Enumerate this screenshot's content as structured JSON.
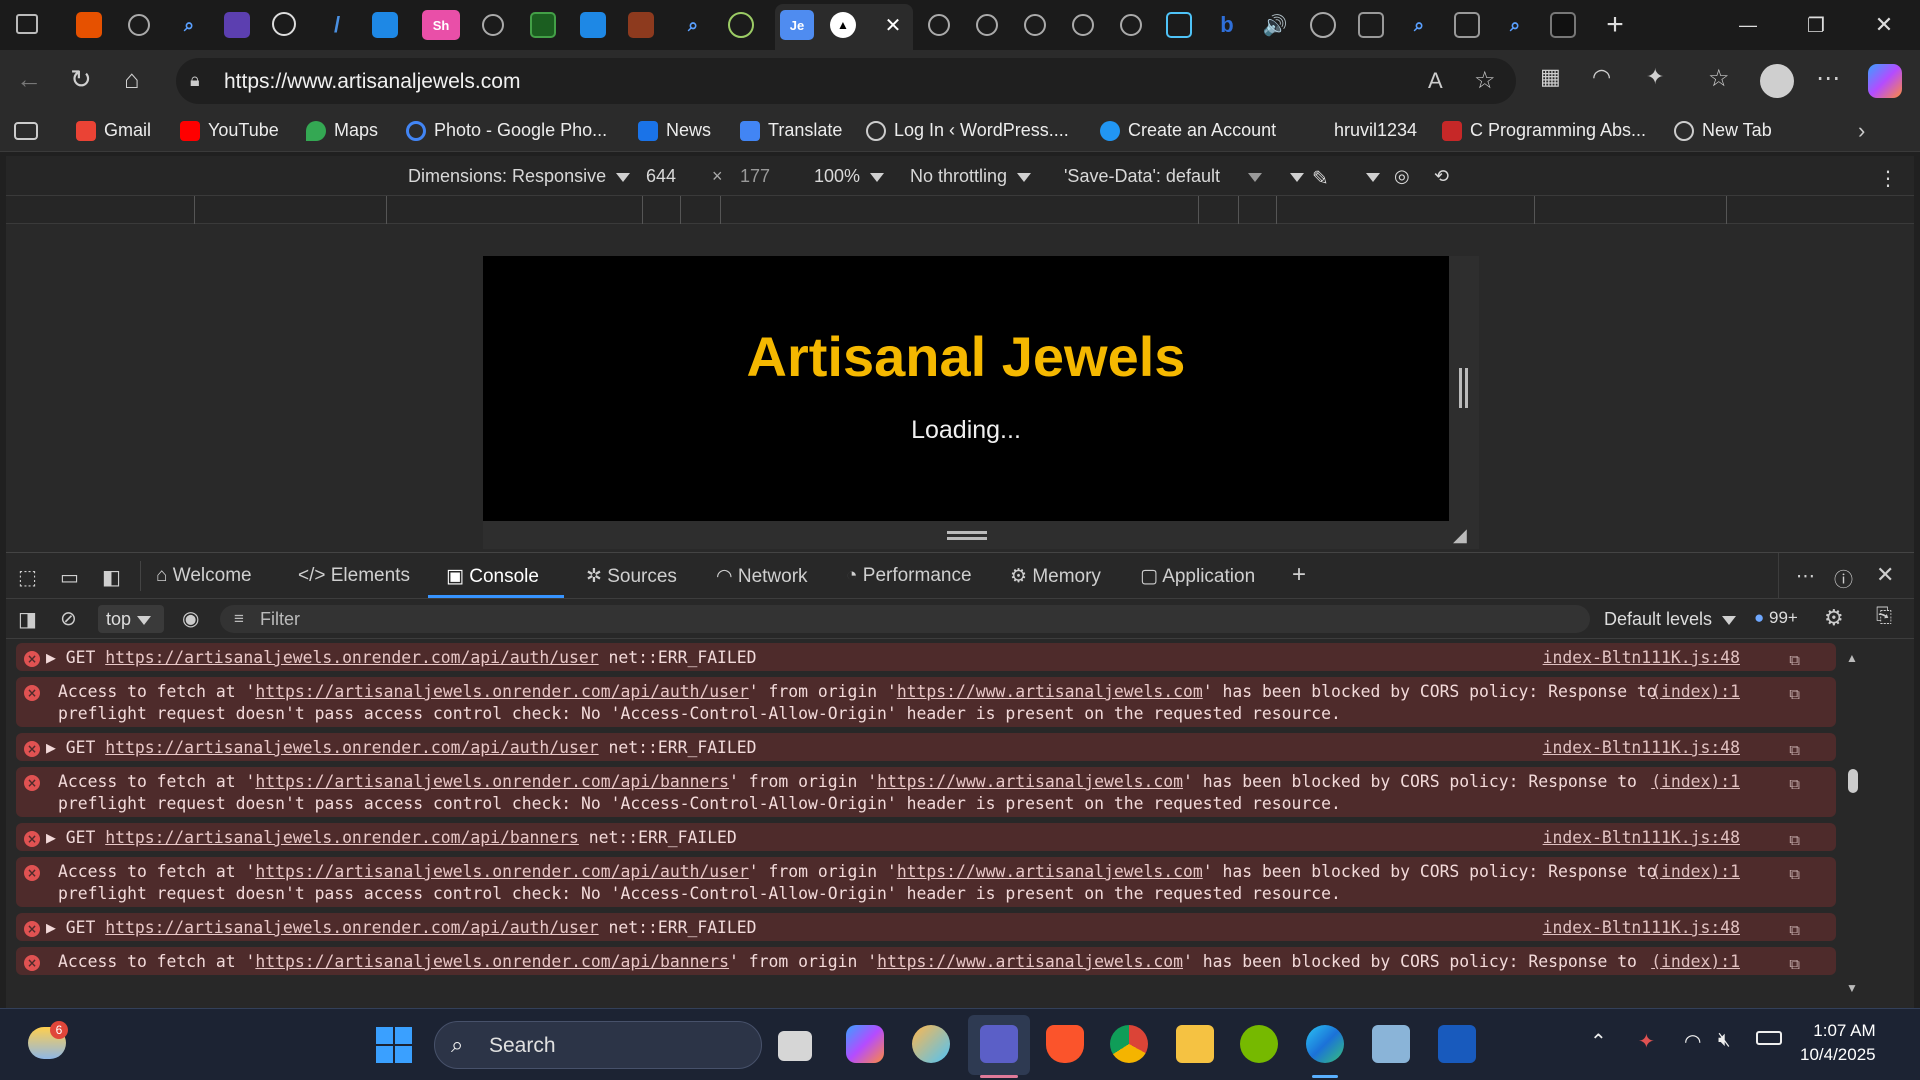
{
  "tabs": {
    "small_labels": [
      "Sh",
      "Je"
    ],
    "active_close": "✕",
    "new_tab": "+"
  },
  "window": {
    "minimize": "—",
    "restore": "❐",
    "close": "✕"
  },
  "address": {
    "url": "https://www.artisanaljewels.com"
  },
  "bookmarks": [
    {
      "label": "Gmail",
      "color": "#ea4335"
    },
    {
      "label": "YouTube",
      "color": "#ff0000"
    },
    {
      "label": "Maps",
      "color": "#34a853"
    },
    {
      "label": "Photo - Google Pho...",
      "color": "#4285f4"
    },
    {
      "label": "News",
      "color": "#1a73e8"
    },
    {
      "label": "Translate",
      "color": "#4285f4"
    },
    {
      "label": "Log In ‹ WordPress....",
      "color": "#cccccc"
    },
    {
      "label": "Create an Account",
      "color": "#2196f3"
    },
    {
      "label": "hruvil1234",
      "color": "#2b2b2b"
    },
    {
      "label": "C Programming Abs...",
      "color": "#c62828"
    },
    {
      "label": "New Tab",
      "color": "#cccccc"
    }
  ],
  "device_toolbar": {
    "dimensions": "Dimensions: Responsive",
    "width": "644",
    "times": "×",
    "height": "177",
    "zoom": "100%",
    "throttling": "No throttling",
    "save_data": "'Save-Data': default",
    "more": "⋮"
  },
  "site": {
    "title": "Artisanal Jewels",
    "status": "Loading...",
    "title_color": "#f5b800"
  },
  "devtools_tabs": [
    "Welcome",
    "Elements",
    "Console",
    "Sources",
    "Network",
    "Performance",
    "Memory",
    "Application"
  ],
  "devtools_active_tab": "Console",
  "console_bar": {
    "context": "top",
    "filter_placeholder": "Filter",
    "levels": "Default levels",
    "issues_count": "99+"
  },
  "messages": [
    {
      "type": "get",
      "prefix": "GET ",
      "url": "https://artisanaljewels.onrender.com/api/auth/user",
      "suffix": " net::ERR_FAILED",
      "source": "index-Bltn111K.js:48"
    },
    {
      "type": "cors",
      "p1": "Access to fetch at '",
      "url": "https://artisanaljewels.onrender.com/api/auth/user",
      "p2": "' from origin '",
      "origin": "https://www.artisanaljewels.com",
      "p3": "' has been blocked by CORS policy: Response to\npreflight request doesn't pass access control check: No 'Access-Control-Allow-Origin' header is present on the requested resource.",
      "source": "(index):1"
    },
    {
      "type": "get",
      "prefix": "GET ",
      "url": "https://artisanaljewels.onrender.com/api/auth/user",
      "suffix": " net::ERR_FAILED",
      "source": "index-Bltn111K.js:48"
    },
    {
      "type": "cors",
      "p1": "Access to fetch at '",
      "url": "https://artisanaljewels.onrender.com/api/banners",
      "p2": "' from origin '",
      "origin": "https://www.artisanaljewels.com",
      "p3": "' has been blocked by CORS policy: Response to\npreflight request doesn't pass access control check: No 'Access-Control-Allow-Origin' header is present on the requested resource.",
      "source": "(index):1"
    },
    {
      "type": "get",
      "prefix": "GET ",
      "url": "https://artisanaljewels.onrender.com/api/banners",
      "suffix": " net::ERR_FAILED",
      "source": "index-Bltn111K.js:48"
    },
    {
      "type": "cors",
      "p1": "Access to fetch at '",
      "url": "https://artisanaljewels.onrender.com/api/auth/user",
      "p2": "' from origin '",
      "origin": "https://www.artisanaljewels.com",
      "p3": "' has been blocked by CORS policy: Response to\npreflight request doesn't pass access control check: No 'Access-Control-Allow-Origin' header is present on the requested resource.",
      "source": "(index):1"
    },
    {
      "type": "get",
      "prefix": "GET ",
      "url": "https://artisanaljewels.onrender.com/api/auth/user",
      "suffix": " net::ERR_FAILED",
      "source": "index-Bltn111K.js:48"
    },
    {
      "type": "cors",
      "p1": "Access to fetch at '",
      "url": "https://artisanaljewels.onrender.com/api/banners",
      "p2": "' from origin '",
      "origin": "https://www.artisanaljewels.com",
      "p3": "' has been blocked by CORS policy: Response to",
      "source": "(index):1"
    }
  ],
  "taskbar": {
    "weather_badge": "6",
    "search_placeholder": "Search",
    "time": "1:07 AM",
    "date": "10/4/2025"
  }
}
